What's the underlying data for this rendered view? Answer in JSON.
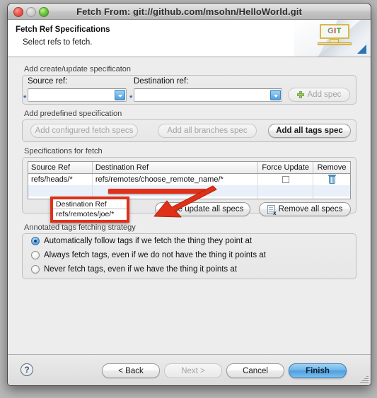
{
  "window": {
    "title": "Fetch From: git://github.com/msohn/HelloWorld.git",
    "traffic_lights": [
      "close-button",
      "minimize-button",
      "zoom-button"
    ]
  },
  "header": {
    "title": "Fetch Ref Specifications",
    "subtitle": "Select refs to fetch.",
    "logo_letters": [
      "G",
      "I",
      "T"
    ],
    "logo_colors": [
      "#7a8a7a",
      "#cc2a2a",
      "#3f9e3f"
    ]
  },
  "create_update_group": {
    "label": "Add create/update specificaton",
    "source_ref": {
      "label": "Source ref:",
      "value": "",
      "required_marker": "*"
    },
    "destination_ref": {
      "label": "Destination ref:",
      "value": "",
      "required_marker": "*"
    },
    "add_spec_button": {
      "label": "Add spec",
      "enabled": false,
      "icon": "plus-icon"
    }
  },
  "predefined_group": {
    "label": "Add predefined specification",
    "buttons": [
      {
        "label": "Add configured fetch specs",
        "enabled": false
      },
      {
        "label": "Add all branches spec",
        "enabled": false
      },
      {
        "label": "Add all tags spec",
        "enabled": true
      }
    ]
  },
  "specs_group": {
    "label": "Specifications for fetch",
    "columns": [
      "Source Ref",
      "Destination Ref",
      "Force Update",
      "Remove"
    ],
    "rows": [
      {
        "source_ref": "refs/heads/*",
        "destination_ref": "refs/remotes/choose_remote_name/*",
        "force_update": false,
        "remove_icon": "trash-icon"
      }
    ],
    "empty_rows": 2,
    "buttons": [
      {
        "label": "Force update all specs",
        "enabled": true
      },
      {
        "label": "Remove all specs",
        "enabled": true,
        "icon": "remove-doc-icon"
      }
    ]
  },
  "tags_group": {
    "label": "Annotated tags fetching strategy",
    "options": [
      {
        "label": "Automatically follow tags if we fetch the thing they point at",
        "selected": true
      },
      {
        "label": "Always fetch tags, even if we do not have the thing it points at",
        "selected": false
      },
      {
        "label": "Never fetch tags, even if we have the thing it points at",
        "selected": false
      }
    ]
  },
  "footer": {
    "help_label": "?",
    "buttons": [
      {
        "label": "< Back",
        "enabled": true,
        "primary": false
      },
      {
        "label": "Next >",
        "enabled": false,
        "primary": false
      },
      {
        "label": "Cancel",
        "enabled": true,
        "primary": false
      },
      {
        "label": "Finish",
        "enabled": true,
        "primary": true
      }
    ]
  },
  "annotation": {
    "color": "#e03018",
    "callout_header": "Destination Ref",
    "callout_value": "refs/remotes/joe/*"
  }
}
